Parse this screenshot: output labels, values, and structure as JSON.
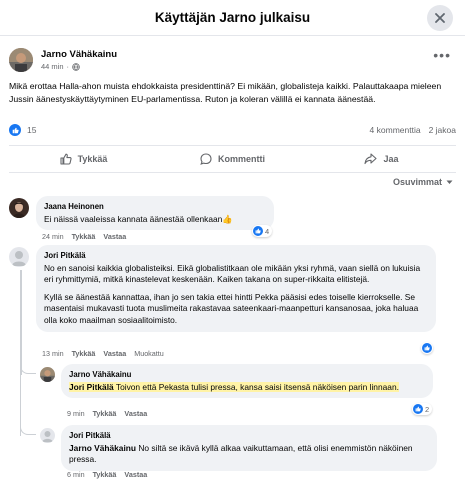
{
  "header": {
    "title": "Käyttäjän Jarno julkaisu",
    "close_icon": "close-icon"
  },
  "post": {
    "author": "Jarno Vähäkainu",
    "time": "44 min",
    "visibility_icon": "globe-icon",
    "text": "Mikä erottaa Halla-ahon muista ehdokkaista presidenttinä? Ei mikään, globalisteja kaikki. Palauttakaapa mieleen Jussin äänestyskäyttäytyminen EU-parlamentissa. Ruton ja koleran välillä ei kannata äänestää.",
    "reaction_count": "15",
    "comments_count": "4 kommenttia",
    "shares_count": "2 jakoa"
  },
  "actions": {
    "like": "Tykkää",
    "comment": "Kommentti",
    "share": "Jaa"
  },
  "sort_label": "Osuvimmat",
  "comments": [
    {
      "author": "Jaana Heinonen",
      "text": "Ei näissä vaaleissa kannata äänestää ollenkaan👍",
      "time": "24 min",
      "like": "Tykkää",
      "reply": "Vastaa",
      "reactions": "4"
    },
    {
      "author": "Jori Pitkälä",
      "p1": "No en sanoisi kaikkia globalisteiksi. Eikä globalistitkaan ole mikään yksi ryhmä, vaan siellä on lukuisia eri ryhmittymiä, mitkä kinastelevat keskenään. Kaiken takana on super-rikkaita elitistejä.",
      "p2": "Kyllä se äänestää kannattaa, ihan jo sen takia ettei hintti Pekka pääsisi edes toiselle kierrokselle. Se masentaisi mukavasti tuota muslimeita rakastavaa sateenkaari-maanpetturi kansanosaa, joka haluaa olla koko maailman sosiaalitoimisto.",
      "time": "13 min",
      "like": "Tykkää",
      "reply": "Vastaa",
      "edited": "Muokattu"
    },
    {
      "author": "Jarno Vähäkainu",
      "mention": "Jori Pitkälä",
      "text": " Toivon että Pekasta tulisi pressa, kansa saisi itsensä näköisen parin linnaan.",
      "time": "9 min",
      "like": "Tykkää",
      "reply": "Vastaa",
      "reactions": "2"
    },
    {
      "author": "Jori Pitkälä",
      "mention": "Jarno Vähäkainu",
      "text": " No siltä se ikävä kyllä alkaa vaikuttamaan, että olisi enemmistön näköinen pressa.",
      "time": "6 min",
      "like": "Tykkää",
      "reply": "Vastaa"
    }
  ],
  "colors": {
    "accent": "#1877f2",
    "highlight": "#fff3a6",
    "bubble": "#f0f2f5",
    "muted": "#65676b"
  }
}
